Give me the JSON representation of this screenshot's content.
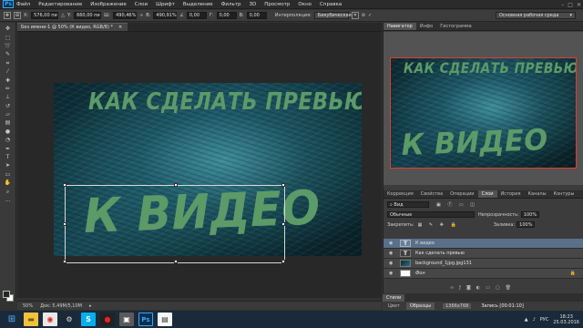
{
  "app": {
    "logo": "Ps"
  },
  "menu": [
    "Файл",
    "Редактирование",
    "Изображение",
    "Слои",
    "Шрифт",
    "Выделение",
    "Фильтр",
    "3D",
    "Просмотр",
    "Окно",
    "Справка"
  ],
  "options": {
    "x_label": "X:",
    "x_value": "576,00 пи",
    "y_label": "Y:",
    "y_value": "660,00 пи",
    "w_label": "Ш:",
    "w_value": "490,46%",
    "h_label": "В:",
    "h_value": "490,91%",
    "angle_value": "0,00",
    "h_skew_label": "Г:",
    "h_skew_value": "0,00",
    "v_skew_label": "В:",
    "v_skew_value": "0,00",
    "interp_label": "Интерполяция:",
    "interp_value": "Бикубическая",
    "workspace": "Основная рабочая среда"
  },
  "document": {
    "tab_title": "Без имени-1 @ 50% (К видео, RGB/8) *",
    "line1": "КАК СДЕЛАТЬ ПРЕВЬЮ",
    "line2": "К ВИДЕО"
  },
  "status": {
    "zoom": "50%",
    "doc": "Док: 5,49M/5,10M"
  },
  "navigator": {
    "tabs": [
      "Навигатор",
      "Инфо",
      "Гистограмма"
    ]
  },
  "layers_panel": {
    "tabs": [
      "Коррекция",
      "Свойства",
      "Операции",
      "Слои",
      "История",
      "Каналы",
      "Контуры"
    ],
    "filter": "Вид",
    "blend_mode": "Обычные",
    "opacity_label": "Непрозрачность:",
    "opacity_value": "100%",
    "lock_label": "Закрепить:",
    "fill_label": "Заливка:",
    "fill_value": "100%",
    "layers": [
      {
        "name": "К видео",
        "kind": "T",
        "selected": true
      },
      {
        "name": "Как сделать превью",
        "kind": "T",
        "selected": false
      },
      {
        "name": "background_1jpg.jpg131",
        "kind": "img",
        "selected": false
      },
      {
        "name": "Фон",
        "kind": "bg",
        "selected": false
      }
    ]
  },
  "bottom_panel": {
    "tabs": [
      "Стили"
    ],
    "strip": [
      "Цвет",
      "Образцы"
    ],
    "size": "1366x768",
    "record": "Запись [00:01:10]"
  },
  "taskbar": {
    "lang": "РУС",
    "time": "18:23",
    "date": "25.03.2016"
  }
}
